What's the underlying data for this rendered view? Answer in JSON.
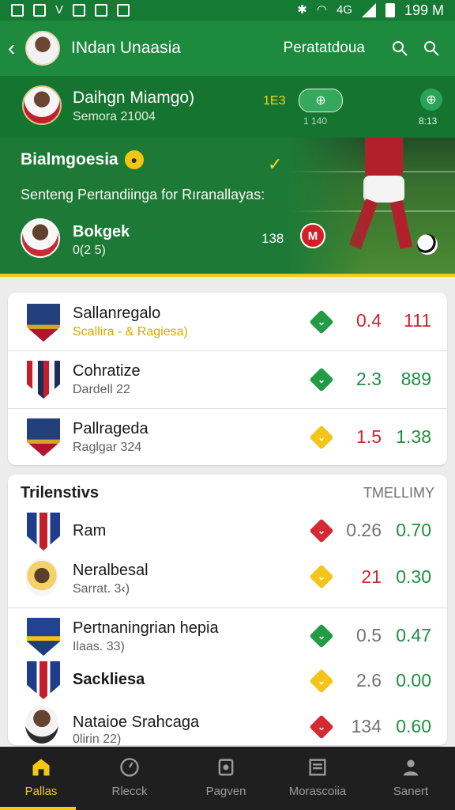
{
  "status": {
    "left_icons": [
      "image-icon",
      "square-icon",
      "letter-v-icon",
      "phone-icon",
      "square-outline-icon",
      "calendar-icon"
    ],
    "right_icons": [
      "bluetooth-icon",
      "wifi-icon",
      "signal-icon",
      "battery-icon"
    ],
    "right_text": "199 M",
    "small_text": "4G"
  },
  "appbar": {
    "title": "INdan Unaasia",
    "subtitle": "Peratatdoua"
  },
  "hero": {
    "top": {
      "name": "Daihgn Miamgo)",
      "date": "Semora 21004",
      "score": "1E3",
      "mini_left": "1 140",
      "mini_right": "8:13"
    },
    "section": {
      "title": "Bialmgoesia",
      "text": "Senteng Pertandiinga for Rıranallayas:"
    },
    "person": {
      "name": "Bokgek",
      "sub": "0(2 5)",
      "value": "138"
    }
  },
  "card1": {
    "rows": [
      {
        "title": "Sallanregalo",
        "sub": "Scallira - & Ragiesa)",
        "left": "0.4",
        "right": "111"
      },
      {
        "title": "Cohratize",
        "sub": "Dardell 22",
        "left": "2.3",
        "right": "889"
      },
      {
        "title": "Pallrageda",
        "sub": "Raglgar 324",
        "left": "1.5",
        "right": "1.38"
      }
    ]
  },
  "card2": {
    "header": {
      "title": "Trilenstivs",
      "right": "TMELLIMY"
    },
    "rows": [
      {
        "title": "Ram",
        "sub": "",
        "left": "0.26",
        "right": "0.70"
      },
      {
        "title": "Neralbesal",
        "sub": "Sarrat. 3‹)",
        "left": "21",
        "right": "0.30"
      },
      {
        "title": "Pertnaningrian hepia",
        "sub": "Ilaas. 33)",
        "left": "0.5",
        "right": "0.47"
      },
      {
        "title": "Sackliesa",
        "sub": "",
        "left": "2.6",
        "right": "0.00"
      },
      {
        "title": "Nataioe Srahcaga",
        "sub": "0lirin 22)",
        "left": "134",
        "right": "0.60"
      }
    ]
  },
  "tabs": [
    {
      "label": "Pallas",
      "icon": "home-icon"
    },
    {
      "label": "Rlecck",
      "icon": "clock-icon"
    },
    {
      "label": "Pagven",
      "icon": "device-icon"
    },
    {
      "label": "Morascoiia",
      "icon": "news-icon"
    },
    {
      "label": "Sanert",
      "icon": "user-icon"
    }
  ],
  "colors": {
    "brand_green": "#1d8a3d",
    "accent_yellow": "#f2c812",
    "positive": "#1d8f40",
    "negative": "#d3232d",
    "tabbar": "#1f1f1f"
  }
}
